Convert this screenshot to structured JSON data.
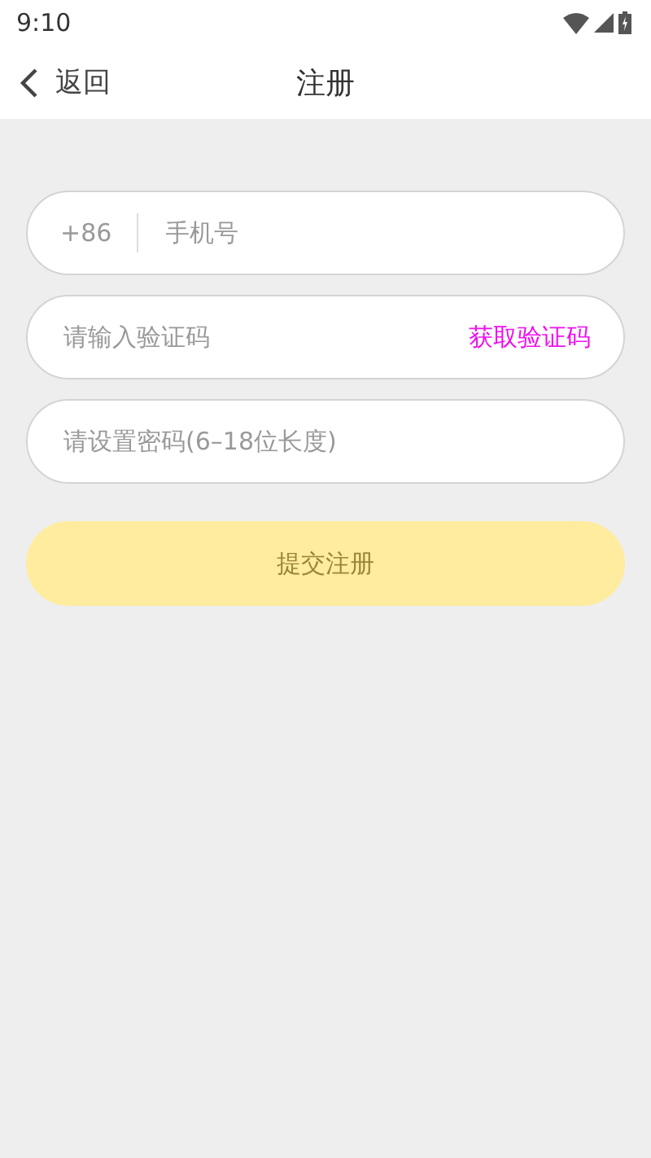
{
  "status_bar": {
    "time": "9:10"
  },
  "header": {
    "back_label": "返回",
    "title": "注册"
  },
  "phone": {
    "country_code": "+86",
    "placeholder": "手机号"
  },
  "code": {
    "placeholder": "请输入验证码",
    "action": "获取验证码"
  },
  "password": {
    "placeholder": "请设置密码(6–18位长度)"
  },
  "submit": {
    "label": "提交注册",
    "disabled": true
  }
}
